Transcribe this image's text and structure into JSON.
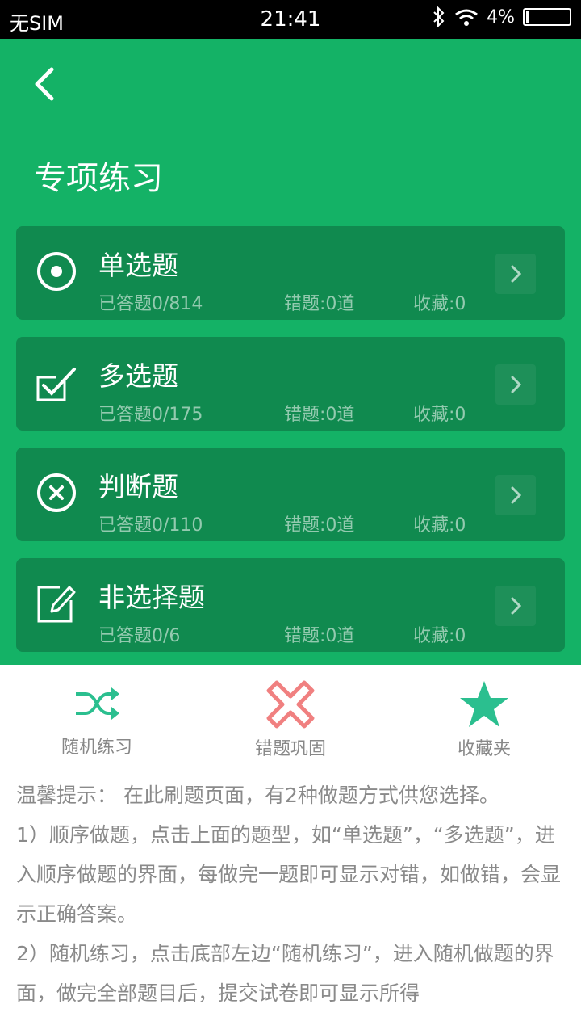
{
  "status_bar": {
    "carrier": "无SIM",
    "time": "21:41",
    "battery": "4%"
  },
  "header": {
    "title": "专项练习"
  },
  "cards": [
    {
      "name": "单选题",
      "answered": "已答题0/814",
      "wrong": "错题:0道",
      "fav": "收藏:0",
      "icon": "radio-icon"
    },
    {
      "name": "多选题",
      "answered": "已答题0/175",
      "wrong": "错题:0道",
      "fav": "收藏:0",
      "icon": "checkbox-icon"
    },
    {
      "name": "判断题",
      "answered": "已答题0/110",
      "wrong": "错题:0道",
      "fav": "收藏:0",
      "icon": "cross-circle-icon"
    },
    {
      "name": "非选择题",
      "answered": "已答题0/6",
      "wrong": "错题:0道",
      "fav": "收藏:0",
      "icon": "edit-icon"
    }
  ],
  "bottom_nav": [
    {
      "label": "随机练习",
      "icon": "shuffle-icon",
      "color": "#2bbf8f"
    },
    {
      "label": "错题巩固",
      "icon": "x-mark-icon",
      "color": "#f08080"
    },
    {
      "label": "收藏夹",
      "icon": "star-icon",
      "color": "#2bbf8f"
    }
  ],
  "tips": [
    "温馨提示： 在此刷题页面，有2种做题方式供您选择。",
    "1）顺序做题，点击上面的题型，如“单选题”，“多选题”，进入顺序做题的界面，每做完一题即可显示对错，如做错，会显示正确答案。",
    "2）随机练习，点击底部左边“随机练习”，进入随机做题的界面，做完全部题目后，提交试卷即可显示所得"
  ]
}
